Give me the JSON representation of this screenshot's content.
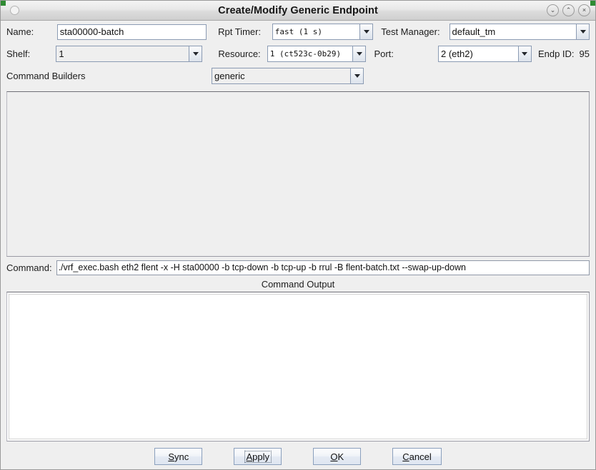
{
  "window": {
    "title": "Create/Modify Generic Endpoint",
    "controls": {
      "minimize": "⌄",
      "maximize": "⌃",
      "close": "×"
    }
  },
  "form": {
    "name": {
      "label": "Name:",
      "value": "sta00000-batch"
    },
    "rpt_timer": {
      "label": "Rpt Timer:",
      "value": "fast    (1 s)"
    },
    "test_manager": {
      "label": "Test Manager:",
      "value": "default_tm"
    },
    "shelf": {
      "label": "Shelf:",
      "value": "1"
    },
    "resource": {
      "label": "Resource:",
      "value": "1 (ct523c-0b29)"
    },
    "port": {
      "label": "Port:",
      "value": "2 (eth2)"
    },
    "endp_id": {
      "label": "Endp ID:",
      "value": "95"
    },
    "command_builders": {
      "label": "Command Builders",
      "value": "generic"
    }
  },
  "command": {
    "label": "Command:",
    "value": "./vrf_exec.bash eth2 flent -x -H sta00000 -b tcp-down -b tcp-up -b rrul -B flent-batch.txt --swap-up-down"
  },
  "command_output": {
    "title": "Command Output",
    "text": ""
  },
  "buttons": {
    "sync": {
      "pre": "",
      "mn": "S",
      "post": "ync"
    },
    "apply": {
      "pre": "",
      "mn": "A",
      "post": "pply"
    },
    "ok": {
      "pre": "",
      "mn": "O",
      "post": "K"
    },
    "cancel": {
      "pre": "",
      "mn": "C",
      "post": "ancel"
    }
  }
}
